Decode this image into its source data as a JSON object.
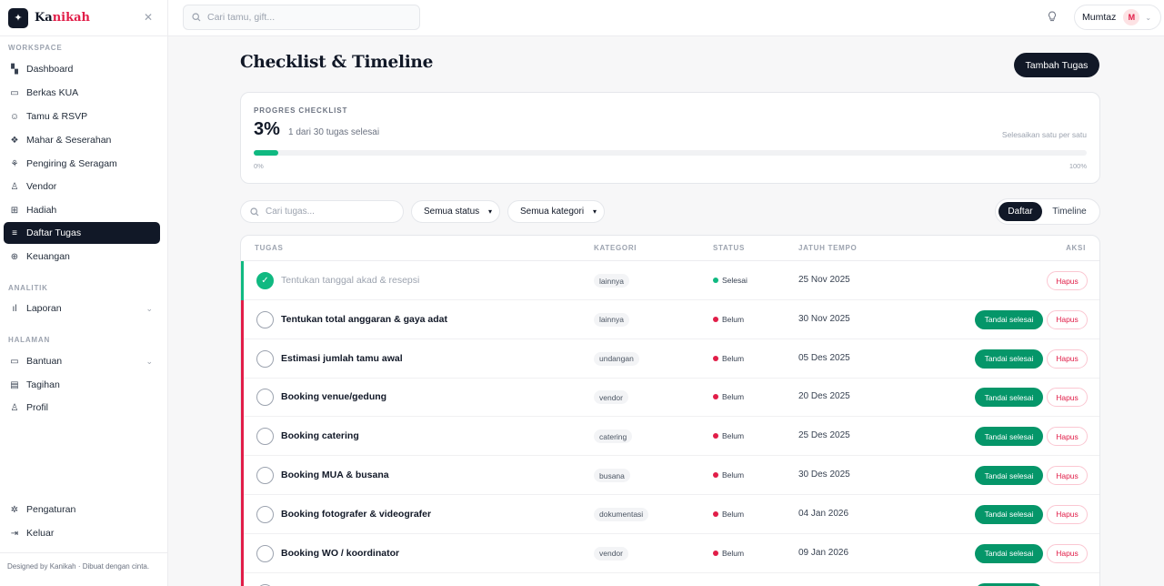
{
  "brand": {
    "name_pre": "Ka",
    "name_hl": "nikah",
    "logo_glyph": "✦",
    "close_glyph": "✕"
  },
  "sidebar": {
    "sections": {
      "workspace": "WORKSPACE",
      "analitik": "ANALITIK",
      "halaman": "HALAMAN"
    },
    "items": [
      {
        "label": "Dashboard",
        "icon": "grid-icon",
        "glyph": "▚"
      },
      {
        "label": "Berkas KUA",
        "icon": "card-icon",
        "glyph": "▭"
      },
      {
        "label": "Tamu & RSVP",
        "icon": "users-icon",
        "glyph": "☺"
      },
      {
        "label": "Mahar & Seserahan",
        "icon": "sparkle-icon",
        "glyph": "❖"
      },
      {
        "label": "Pengiring & Seragam",
        "icon": "shirt-icon",
        "glyph": "⚘"
      },
      {
        "label": "Vendor",
        "icon": "user-icon",
        "glyph": "♙"
      },
      {
        "label": "Hadiah",
        "icon": "gift-icon",
        "glyph": "⊞"
      },
      {
        "label": "Daftar Tugas",
        "icon": "list-icon",
        "glyph": "≡"
      },
      {
        "label": "Keuangan",
        "icon": "coin-icon",
        "glyph": "⊕"
      },
      {
        "label": "Laporan",
        "icon": "chart-icon",
        "glyph": "ıl"
      },
      {
        "label": "Bantuan",
        "icon": "help-icon",
        "glyph": "▭"
      },
      {
        "label": "Tagihan",
        "icon": "file-icon",
        "glyph": "▤"
      },
      {
        "label": "Profil",
        "icon": "profile-icon",
        "glyph": "♙"
      },
      {
        "label": "Pengaturan",
        "icon": "gear-icon",
        "glyph": "✲"
      },
      {
        "label": "Keluar",
        "icon": "logout-icon",
        "glyph": "⇥"
      }
    ],
    "footer": "Designed by Kanikah · Dibuat dengan cinta."
  },
  "topbar": {
    "search_placeholder": "Cari tamu, gift...",
    "user_name": "Mumtaz",
    "avatar_initial": "M"
  },
  "page": {
    "title": "Checklist & Timeline",
    "add_button": "Tambah Tugas"
  },
  "progress": {
    "label": "PROGRES CHECKLIST",
    "percent_text": "3%",
    "percent_value": 3,
    "subtitle": "1 dari 30 tugas selesai",
    "hint": "Selesaikan satu per satu",
    "min_label": "0%",
    "max_label": "100%"
  },
  "filters": {
    "search_placeholder": "Cari tugas...",
    "status_select": "Semua status",
    "category_select": "Semua kategori",
    "view_list": "Daftar",
    "view_timeline": "Timeline"
  },
  "table": {
    "headers": {
      "task": "TUGAS",
      "category": "KATEGORI",
      "status": "STATUS",
      "due": "JATUH TEMPO",
      "action": "AKSI"
    },
    "mark_label": "Tandai selesai",
    "delete_label": "Hapus",
    "rows": [
      {
        "task": "Tentukan tanggal akad & resepsi",
        "category": "lainnya",
        "status": "Selesai",
        "due": "25 Nov 2025",
        "done": true
      },
      {
        "task": "Tentukan total anggaran & gaya adat",
        "category": "lainnya",
        "status": "Belum",
        "due": "30 Nov 2025",
        "done": false
      },
      {
        "task": "Estimasi jumlah tamu awal",
        "category": "undangan",
        "status": "Belum",
        "due": "05 Des 2025",
        "done": false
      },
      {
        "task": "Booking venue/gedung",
        "category": "vendor",
        "status": "Belum",
        "due": "20 Des 2025",
        "done": false
      },
      {
        "task": "Booking catering",
        "category": "catering",
        "status": "Belum",
        "due": "25 Des 2025",
        "done": false
      },
      {
        "task": "Booking MUA & busana",
        "category": "busana",
        "status": "Belum",
        "due": "30 Des 2025",
        "done": false
      },
      {
        "task": "Booking fotografer & videografer",
        "category": "dokumentasi",
        "status": "Belum",
        "due": "04 Jan 2026",
        "done": false
      },
      {
        "task": "Booking WO / koordinator",
        "category": "vendor",
        "status": "Belum",
        "due": "09 Jan 2026",
        "done": false
      }
    ]
  },
  "colors": {
    "done": "#10b981",
    "pending": "#e11d48",
    "accent": "#111827"
  }
}
